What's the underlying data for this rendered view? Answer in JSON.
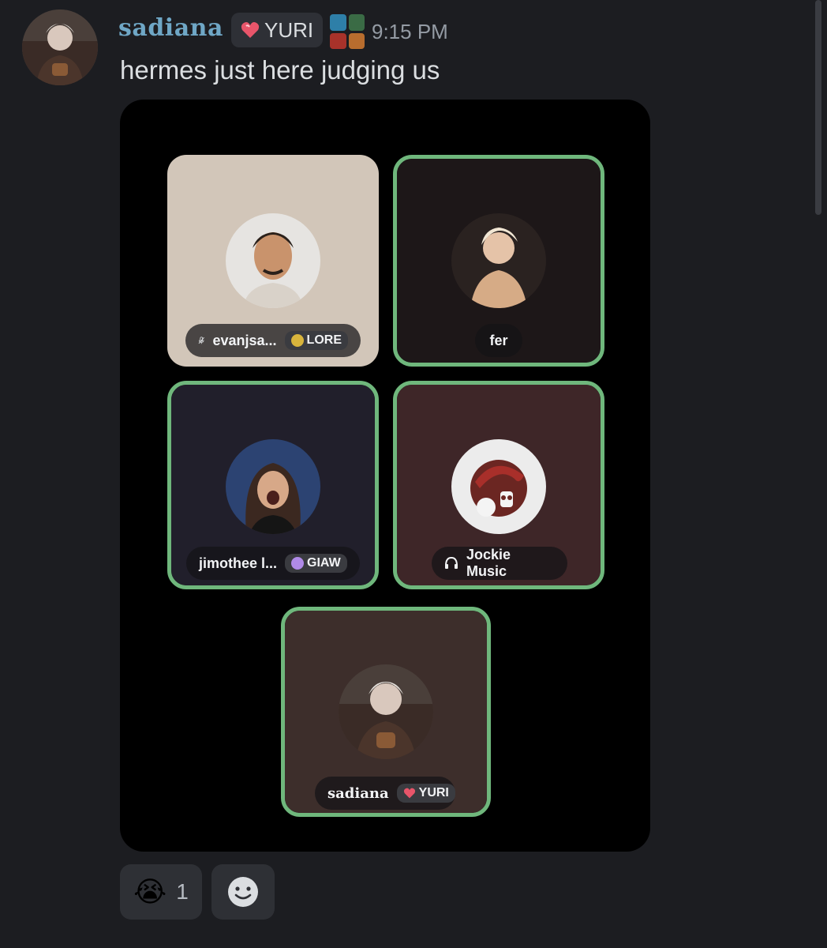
{
  "message": {
    "author": "sadiana",
    "role_tag": "YURI",
    "timestamp": "9:15 PM",
    "text": "hermes just here judging us"
  },
  "call": {
    "participants": [
      {
        "name": "evanjsa...",
        "tag": "LORE",
        "muted": true,
        "speaking": false,
        "tile_color": "#d2c6b9"
      },
      {
        "name": "fer",
        "tag": "",
        "muted": false,
        "speaking": true,
        "tile_color": "#1d1718"
      },
      {
        "name": "jimothee l...",
        "tag": "GIAW",
        "muted": false,
        "speaking": true,
        "tile_color": "#211f2b"
      },
      {
        "name": "Jockie Music",
        "tag": "",
        "muted": false,
        "speaking": true,
        "tile_color": "#3e2628"
      },
      {
        "name": "sadiana",
        "tag": "YURI",
        "muted": false,
        "speaking": true,
        "tile_color": "#3d2e2b"
      }
    ]
  },
  "reactions": [
    {
      "emoji": "😭",
      "count": "1"
    }
  ],
  "icons": {
    "add_reaction": "smile-icon",
    "muted": "mic-muted-icon",
    "bot": "headphones-icon"
  },
  "colors": {
    "speaking_border": "#6fb77c",
    "username": "#6fa7c6",
    "background": "#1c1d21"
  }
}
